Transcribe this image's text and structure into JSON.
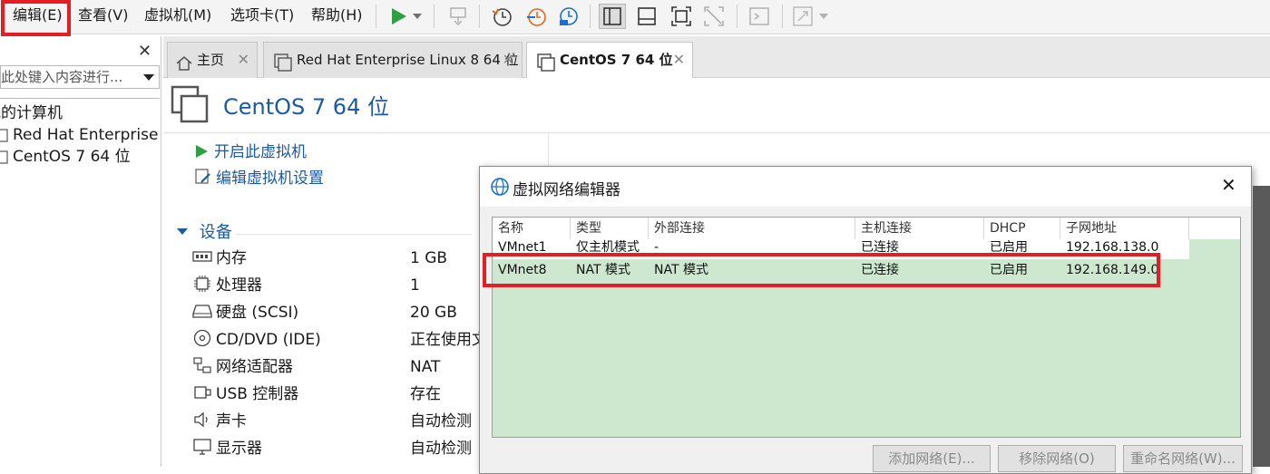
{
  "menubar": {
    "items": [
      "编辑(E)",
      "查看(V)",
      "虚拟机(M)",
      "选项卡(T)",
      "帮助(H)"
    ]
  },
  "library": {
    "search_placeholder": "在此处键入内容进行...",
    "search_visible": "此处键入内容进行...",
    "tree": [
      "我的计算机",
      "Red Hat Enterprise",
      "CentOS 7 64 位"
    ],
    "tree_visible": [
      "我的计算机",
      "Red Hat Enterprise",
      "CentOS 7 64 位"
    ]
  },
  "tabs": [
    {
      "label": "主页"
    },
    {
      "label": "Red Hat Enterprise Linux 8 64 位"
    },
    {
      "label": "CentOS 7 64 位"
    }
  ],
  "vm": {
    "title": "CentOS 7 64 位",
    "actions": [
      "开启此虚拟机",
      "编辑虚拟机设置"
    ],
    "devices_header": "设备",
    "devices": [
      {
        "name": "内存",
        "value": "1 GB",
        "icon": "memory-icon"
      },
      {
        "name": "处理器",
        "value": "1",
        "icon": "cpu-icon"
      },
      {
        "name": "硬盘 (SCSI)",
        "value": "20 GB",
        "icon": "hard-disk-icon"
      },
      {
        "name": "CD/DVD (IDE)",
        "value": "正在使用文",
        "icon": "cd-dvd-icon"
      },
      {
        "name": "网络适配器",
        "value": "NAT",
        "icon": "network-adapter-icon"
      },
      {
        "name": "USB 控制器",
        "value": "存在",
        "icon": "usb-icon"
      },
      {
        "name": "声卡",
        "value": "自动检测",
        "icon": "sound-icon"
      },
      {
        "name": "显示器",
        "value": "自动检测",
        "icon": "display-icon"
      }
    ]
  },
  "dialog": {
    "title": "虚拟网络编辑器",
    "columns": [
      "名称",
      "类型",
      "外部连接",
      "主机连接",
      "DHCP",
      "子网地址"
    ],
    "rows": [
      [
        "VMnet1",
        "仅主机模式",
        "-",
        "已连接",
        "已启用",
        "192.168.138.0"
      ],
      [
        "VMnet8",
        "NAT 模式",
        "NAT 模式",
        "已连接",
        "已启用",
        "192.168.149.0"
      ]
    ],
    "buttons": [
      "添加网络(E)...",
      "移除网络(O)",
      "重命名网络(W)..."
    ]
  },
  "colors": {
    "highlight": "#e31e24",
    "link_blue": "#1c5aa6",
    "table_green": "#cde8cf",
    "play_green": "#2ea043"
  }
}
